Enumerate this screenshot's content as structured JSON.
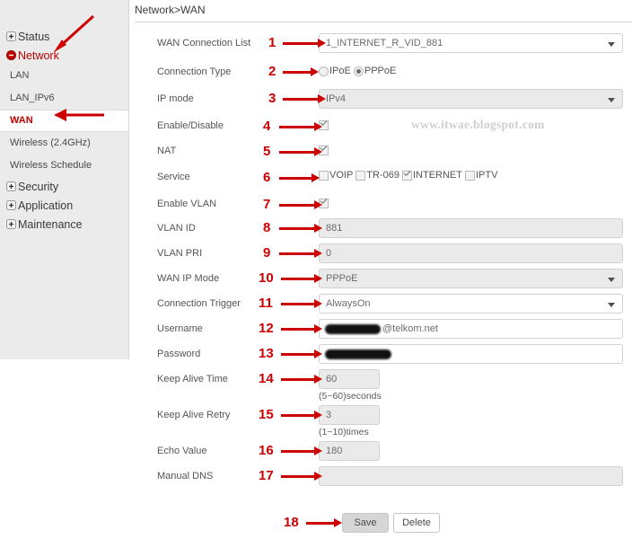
{
  "sidebar": {
    "groups": [
      {
        "label": "Status",
        "state": "collapsed",
        "icon": "plus-box-icon"
      },
      {
        "label": "Network",
        "state": "expanded",
        "icon": "minus-box-icon"
      },
      {
        "label": "Security",
        "state": "collapsed",
        "icon": "plus-box-icon"
      },
      {
        "label": "Application",
        "state": "collapsed",
        "icon": "plus-box-icon"
      },
      {
        "label": "Maintenance",
        "state": "collapsed",
        "icon": "plus-box-icon"
      }
    ],
    "network_children": [
      {
        "label": "LAN",
        "active": false
      },
      {
        "label": "LAN_IPv6",
        "active": false
      },
      {
        "label": "WAN",
        "active": true
      },
      {
        "label": "Wireless (2.4GHz)",
        "active": false
      },
      {
        "label": "Wireless Schedule",
        "active": false
      }
    ]
  },
  "header": {
    "breadcrumb": "Network>WAN"
  },
  "watermark": {
    "text": "www.itwae.blogspot.com"
  },
  "form": {
    "wan_connection_list": {
      "label": "WAN Connection List",
      "value": "1_INTERNET_R_VID_881"
    },
    "connection_type": {
      "label": "Connection Type",
      "options": [
        {
          "label": "IPoE",
          "selected": false
        },
        {
          "label": "PPPoE",
          "selected": true
        }
      ]
    },
    "ip_mode": {
      "label": "IP mode",
      "value": "IPv4"
    },
    "enable_disable": {
      "label": "Enable/Disable",
      "checked": true
    },
    "nat": {
      "label": "NAT",
      "checked": true
    },
    "service": {
      "label": "Service",
      "options": [
        {
          "label": "VOIP",
          "checked": false
        },
        {
          "label": "TR-069",
          "checked": false
        },
        {
          "label": "INTERNET",
          "checked": true
        },
        {
          "label": "IPTV",
          "checked": false
        }
      ]
    },
    "enable_vlan": {
      "label": "Enable VLAN",
      "checked": true
    },
    "vlan_id": {
      "label": "VLAN ID",
      "value": "881"
    },
    "vlan_pri": {
      "label": "VLAN PRI",
      "value": "0"
    },
    "wan_ip_mode": {
      "label": "WAN IP Mode",
      "value": "PPPoE"
    },
    "connection_trigger": {
      "label": "Connection Trigger",
      "value": "AlwaysOn"
    },
    "username": {
      "label": "Username",
      "value": "@telkom.net",
      "redacted": true
    },
    "password": {
      "label": "Password",
      "value": "",
      "redacted": true
    },
    "keep_alive_time": {
      "label": "Keep Alive Time",
      "value": "60",
      "hint": "(5~60)seconds"
    },
    "keep_alive_retry": {
      "label": "Keep Alive Retry",
      "value": "3",
      "hint": "(1~10)times"
    },
    "echo_value": {
      "label": "Echo Value",
      "value": "180"
    },
    "manual_dns": {
      "label": "Manual DNS",
      "value": ""
    }
  },
  "actions": {
    "save": "Save",
    "delete": "Delete"
  },
  "annotations": {
    "numbers": [
      "1",
      "2",
      "3",
      "4",
      "5",
      "6",
      "7",
      "8",
      "9",
      "10",
      "11",
      "12",
      "13",
      "14",
      "15",
      "16",
      "17",
      "18"
    ]
  },
  "colors": {
    "accent_red": "#cc0000",
    "active_nav": "#c00000",
    "sidebar_bg": "#ebebeb",
    "disabled_field": "#eaeaea"
  }
}
